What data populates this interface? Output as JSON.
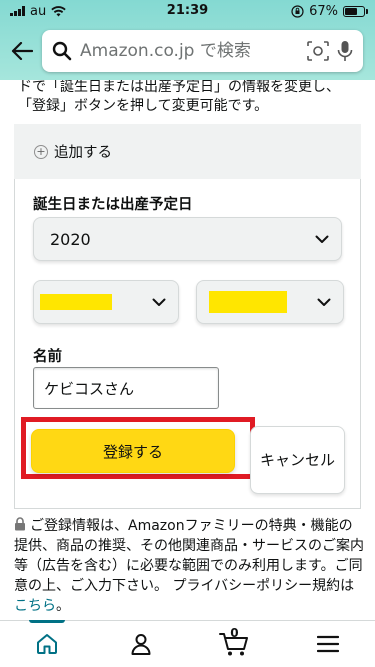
{
  "status_bar": {
    "carrier": "au",
    "time": "21:39",
    "battery": "67%"
  },
  "search": {
    "placeholder": "Amazon.co.jp で検索"
  },
  "intro_text": "ドで「誕生日または出産予定日」の情報を変更し、「登録」ボタンを押して変更可能です。",
  "add_label": "追加する",
  "form": {
    "birthday_label": "誕生日または出産予定日",
    "year_value": "2020",
    "name_label": "名前",
    "name_value": "ケビコスさん",
    "register_label": "登録する",
    "cancel_label": "キャンセル"
  },
  "notice": {
    "text": "ご登録情報は、Amazonファミリーの特典・機能の提供、商品の推奨、その他関連商品・サービスのご案内等（広告を含む）に必要な範囲でのみ利用します。ご同意の上、ご入力下さい。 プライバシーポリシー規約は",
    "link": "こちら",
    "end": "。"
  },
  "nav": {
    "cart_count": "0"
  },
  "colors": {
    "header": "#84d9d2",
    "button": "#ffd814",
    "highlight": "#e01b24",
    "link": "#007185",
    "mask": "#ffe600"
  }
}
